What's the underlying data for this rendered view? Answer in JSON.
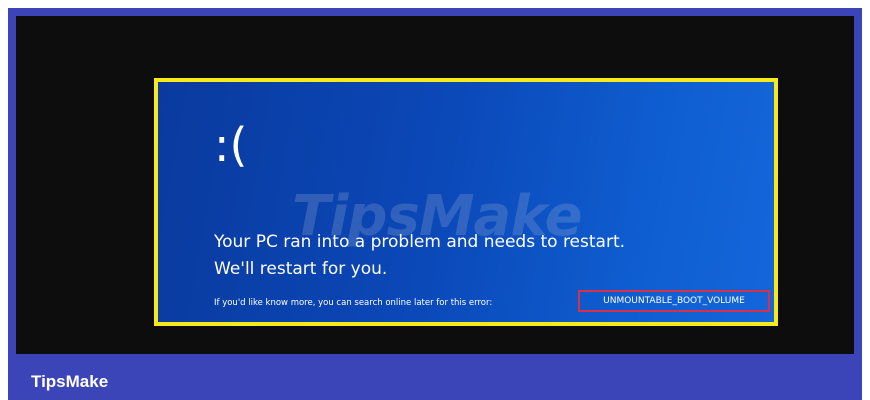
{
  "bsod": {
    "sad_face": ":(",
    "watermark": "TipsMake",
    "line1": "Your PC ran into a problem and needs to restart.",
    "line2": "We'll restart for you.",
    "more_info": "If you'd like know more, you can search online later for this error:",
    "error_code": "UNMOUNTABLE_BOOT_VOLUME"
  },
  "footer": {
    "brand": "TipsMake"
  },
  "colors": {
    "frame_bg": "#3b45b8",
    "bsod_bg": "#0b48b8",
    "highlight_border": "#f6ea1c",
    "error_border": "#d6314a"
  }
}
